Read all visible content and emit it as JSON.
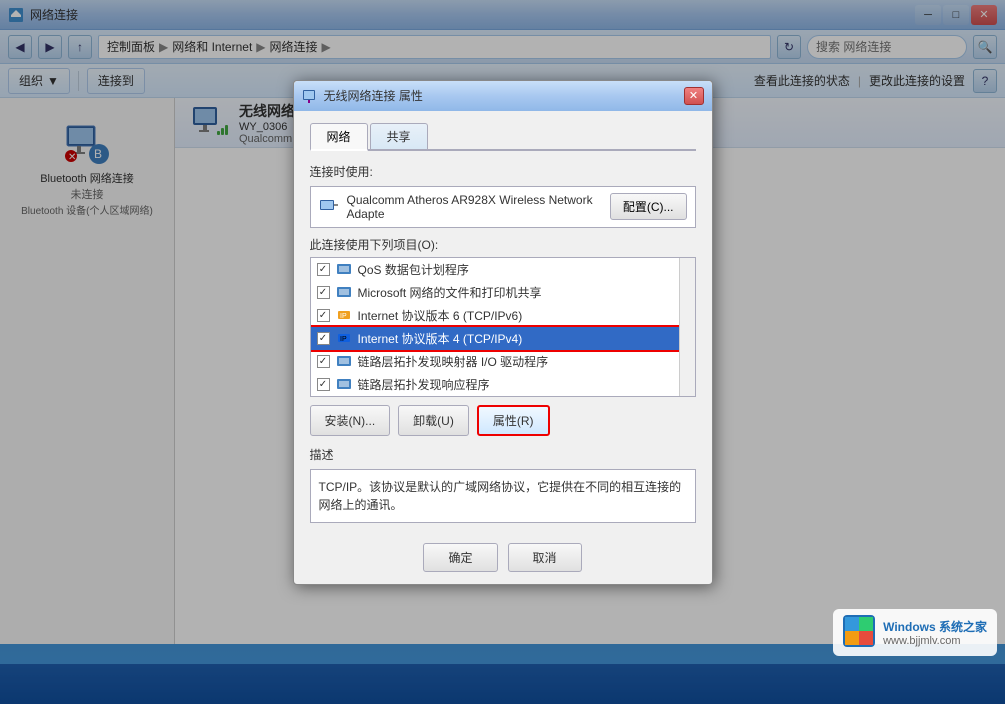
{
  "titlebar": {
    "text": "网络连接",
    "minBtn": "─",
    "maxBtn": "□",
    "closeBtn": "✕"
  },
  "addressbar": {
    "breadcrumb": [
      "控制面板",
      "网络和 Internet",
      "网络连接"
    ],
    "searchPlaceholder": "搜索 网络连接"
  },
  "toolbar": {
    "organizeLabel": "组织",
    "organizeArrow": "▼",
    "connectLabel": "连接到",
    "statusLabel": "查看此连接的状态",
    "changeLabel": "更改此连接的设置",
    "helpIcon": "?"
  },
  "leftPanel": {
    "item1Name": "Bluetooth 网络连接",
    "item1Status": "未连接",
    "item1SubStatus": "Bluetooth 设备(个人区域网络)"
  },
  "rightPanel": {
    "wifiName": "无线网络连接",
    "wifiSSID": "WY_0306",
    "wifiAdapter": "Qualcomm Atheros AR928X W..."
  },
  "dialog": {
    "title": "无线网络连接 属性",
    "closeBtn": "✕",
    "tabs": [
      "网络",
      "共享"
    ],
    "activeTab": "网络",
    "connectUsingLabel": "连接时使用:",
    "adapterName": "Qualcomm Atheros AR928X Wireless Network Adapte",
    "configBtn": "配置(C)...",
    "protocolsLabel": "此连接使用下列项目(O):",
    "protocols": [
      {
        "checked": true,
        "name": "QoS 数据包计划程序"
      },
      {
        "checked": true,
        "name": "Microsoft 网络的文件和打印机共享"
      },
      {
        "checked": true,
        "name": "Internet 协议版本 6 (TCP/IPv6)"
      },
      {
        "checked": true,
        "name": "Internet 协议版本 4 (TCP/IPv4)",
        "selected": true
      },
      {
        "checked": true,
        "name": "链路层拓扑发现映射器 I/O 驱动程序"
      },
      {
        "checked": true,
        "name": "链路层拓扑发现响应程序"
      }
    ],
    "installBtn": "安装(N)...",
    "uninstallBtn": "卸载(U)",
    "propertiesBtn": "属性(R)",
    "descriptionTitle": "描述",
    "descriptionText": "TCP/IP。该协议是默认的广域网络协议，它提供在不同的相互连接的网络上的通讯。",
    "okBtn": "确定",
    "cancelBtn": "取消"
  },
  "watermark": {
    "line1": "Windows 系统之家",
    "line2": "www.bjjmlv.com"
  }
}
